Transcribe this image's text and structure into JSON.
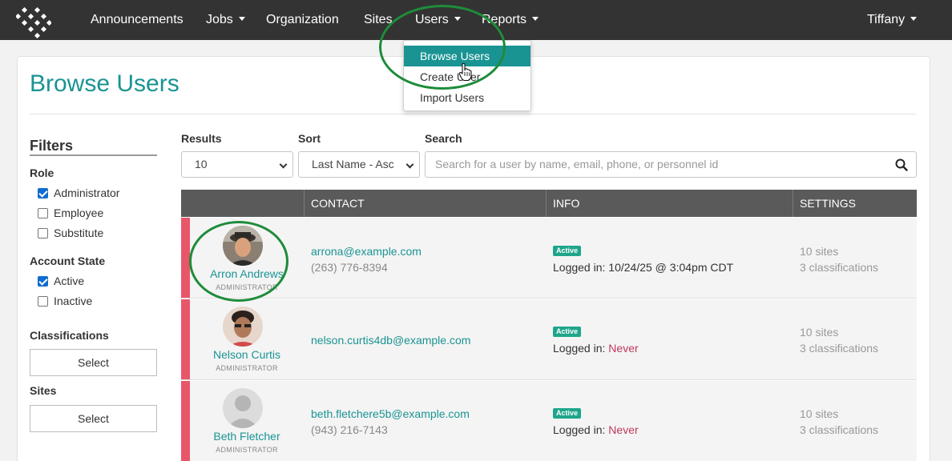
{
  "nav": {
    "items": [
      {
        "label": "Announcements",
        "dropdown": false
      },
      {
        "label": "Jobs",
        "dropdown": true
      },
      {
        "label": "Organization",
        "dropdown": false
      },
      {
        "label": "Sites",
        "dropdown": false
      },
      {
        "label": "Users",
        "dropdown": true
      },
      {
        "label": "Reports",
        "dropdown": true
      }
    ],
    "user": "Tiffany"
  },
  "users_menu": {
    "items": [
      "Browse Users",
      "Create User",
      "Import Users"
    ],
    "active": "Browse Users"
  },
  "page": {
    "title": "Browse Users"
  },
  "filters": {
    "title": "Filters",
    "role": {
      "label": "Role",
      "options": [
        {
          "label": "Administrator",
          "checked": true
        },
        {
          "label": "Employee",
          "checked": false
        },
        {
          "label": "Substitute",
          "checked": false
        }
      ]
    },
    "account_state": {
      "label": "Account State",
      "options": [
        {
          "label": "Active",
          "checked": true
        },
        {
          "label": "Inactive",
          "checked": false
        }
      ]
    },
    "classifications": {
      "label": "Classifications",
      "button": "Select"
    },
    "sites": {
      "label": "Sites",
      "button": "Select"
    }
  },
  "controls": {
    "results_label": "Results",
    "results_value": "10",
    "sort_label": "Sort",
    "sort_value": "Last Name - Asc",
    "search_label": "Search",
    "search_placeholder": "Search for a user by name, email, phone, or personnel id"
  },
  "table": {
    "headers": [
      "CONTACT",
      "INFO",
      "SETTINGS"
    ],
    "rows": [
      {
        "name": "Arron Andrews",
        "role": "ADMINISTRATOR",
        "email": "arrona@example.com",
        "phone": "(263) 776-8394",
        "status": "Active",
        "login_label": "Logged in:",
        "login_value": "10/24/25 @ 3:04pm CDT",
        "sites": "10 sites",
        "classifications": "3 classifications"
      },
      {
        "name": "Nelson Curtis",
        "role": "ADMINISTRATOR",
        "email": "nelson.curtis4db@example.com",
        "phone": "",
        "status": "Active",
        "login_label": "Logged in:",
        "login_value": "Never",
        "sites": "10 sites",
        "classifications": "3 classifications"
      },
      {
        "name": "Beth Fletcher",
        "role": "ADMINISTRATOR",
        "email": "beth.fletchere5b@example.com",
        "phone": "(943) 216-7143",
        "status": "Active",
        "login_label": "Logged in:",
        "login_value": "Never",
        "sites": "10 sites",
        "classifications": "3 classifications"
      }
    ]
  },
  "colors": {
    "accent": "#1a9393",
    "nav_bg": "#333333",
    "row_flag": "#e8566a",
    "badge": "#1fa58b",
    "never": "#c0395b",
    "annotation": "#1e8c3a"
  }
}
